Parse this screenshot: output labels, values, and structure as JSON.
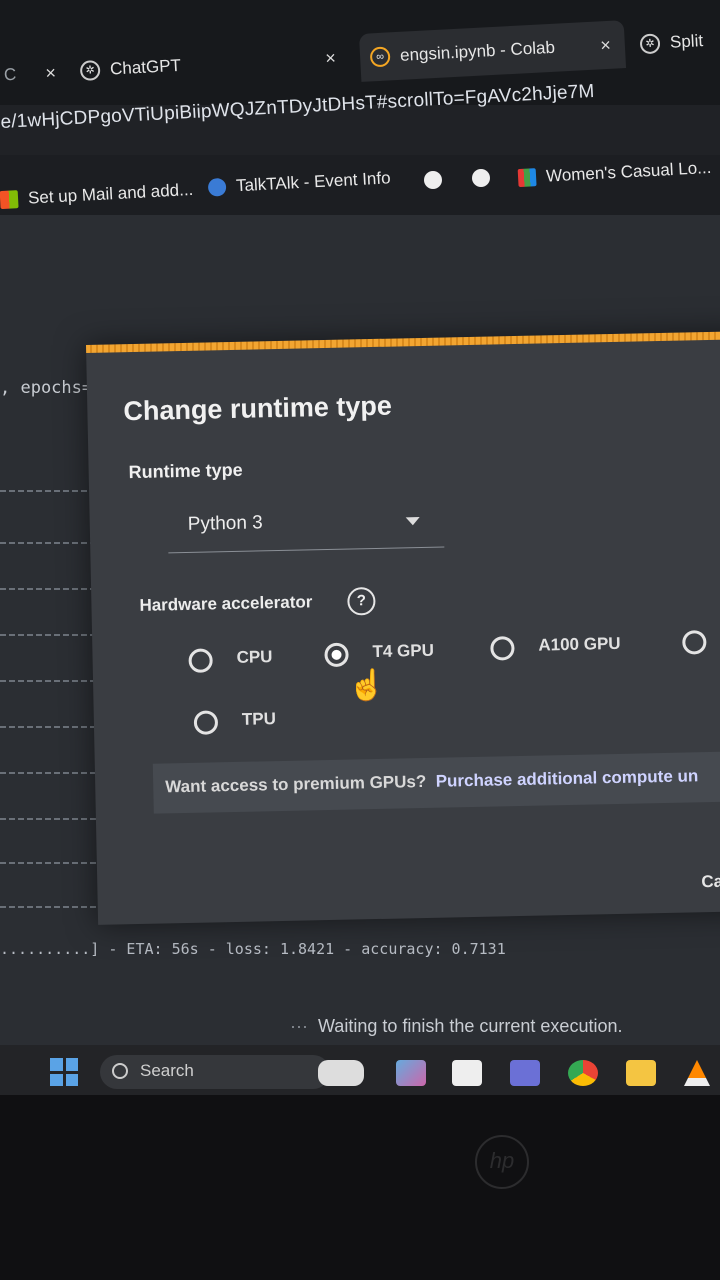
{
  "tabs": [
    {
      "label": "C",
      "close": "×"
    },
    {
      "label": "ChatGPT",
      "close": "×"
    },
    {
      "label": "engsin.ipynb - Colab",
      "close": "×"
    },
    {
      "label": "Split",
      "close": ""
    }
  ],
  "address_bar": {
    "url": "e/1wHjCDPgoVTiUpiBiipWQJZnTDyJtDHsT#scrollTo=FgAVc2hJje7M"
  },
  "bookmarks": [
    {
      "label": "Set up Mail and add..."
    },
    {
      "label": "TalkTAlk - Event Info"
    },
    {
      "label": "Women's Casual Lo..."
    }
  ],
  "notebook": {
    "code_fragment": ", epochs=",
    "output_line": "..........] - ETA: 56s - loss: 1.8421 - accuracy: 0.7131",
    "status": "Waiting to finish the current execution."
  },
  "dialog": {
    "title": "Change runtime type",
    "runtime_label": "Runtime type",
    "runtime_value": "Python 3",
    "hardware_label": "Hardware accelerator",
    "help": "?",
    "options": [
      {
        "label": "CPU",
        "selected": false
      },
      {
        "label": "T4 GPU",
        "selected": true
      },
      {
        "label": "A100 GPU",
        "selected": false
      },
      {
        "label": "",
        "selected": false
      },
      {
        "label": "TPU",
        "selected": false
      }
    ],
    "premium_text": "Want access to premium GPUs?",
    "premium_link": "Purchase additional compute un",
    "cancel": "Ca"
  },
  "taskbar": {
    "search_placeholder": "Search"
  },
  "brand": {
    "logo": "hp"
  },
  "colors": {
    "progress": "#f2a531",
    "taskbar": "#232427",
    "dialog": "#3a3d42"
  }
}
